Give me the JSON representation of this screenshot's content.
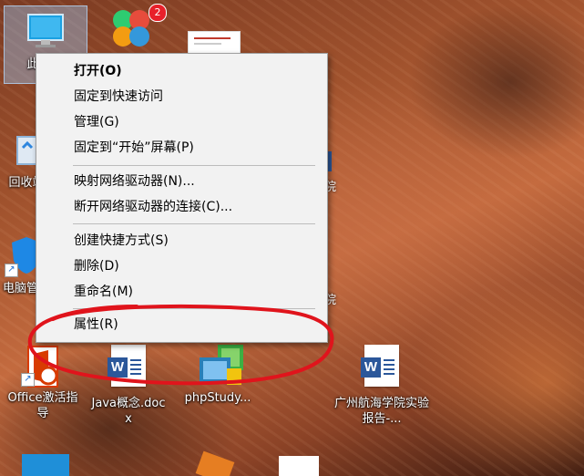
{
  "desktop": {
    "icons": [
      {
        "label": "此电脑",
        "name": "this-pc-icon"
      },
      {
        "label": "",
        "name": "app-launcher-icon",
        "badge": "2"
      },
      {
        "label": "",
        "name": "document-thumbnail-icon"
      },
      {
        "label": "回收站",
        "name": "recycle-bin-icon"
      },
      {
        "label": "电脑管家",
        "name": "pc-manager-icon"
      },
      {
        "label": "院",
        "name": "partial-icon-1"
      },
      {
        "label": "院",
        "name": "partial-icon-2"
      },
      {
        "label": "Office激活指导",
        "name": "office-activation-icon"
      },
      {
        "label": "Java概念.docx",
        "name": "java-docx-icon"
      },
      {
        "label": "phpStudy...",
        "name": "phpstudy-icon"
      },
      {
        "label": "广州航海学院实验报告-...",
        "name": "lab-report-docx-icon"
      }
    ]
  },
  "context_menu": {
    "items": [
      {
        "label": "打开(O)",
        "bold": true
      },
      {
        "label": "固定到快速访问"
      },
      {
        "label": "管理(G)"
      },
      {
        "label": "固定到“开始”屏幕(P)"
      },
      {
        "label": "映射网络驱动器(N)..."
      },
      {
        "label": "断开网络驱动器的连接(C)..."
      },
      {
        "label": "创建快捷方式(S)"
      },
      {
        "label": "删除(D)"
      },
      {
        "label": "重命名(M)"
      },
      {
        "label": "属性(R)"
      }
    ]
  },
  "colors": {
    "annotation": "#e0141c",
    "word_blue": "#2b579a",
    "office_red": "#d83b01",
    "selection": "#96bee6"
  }
}
